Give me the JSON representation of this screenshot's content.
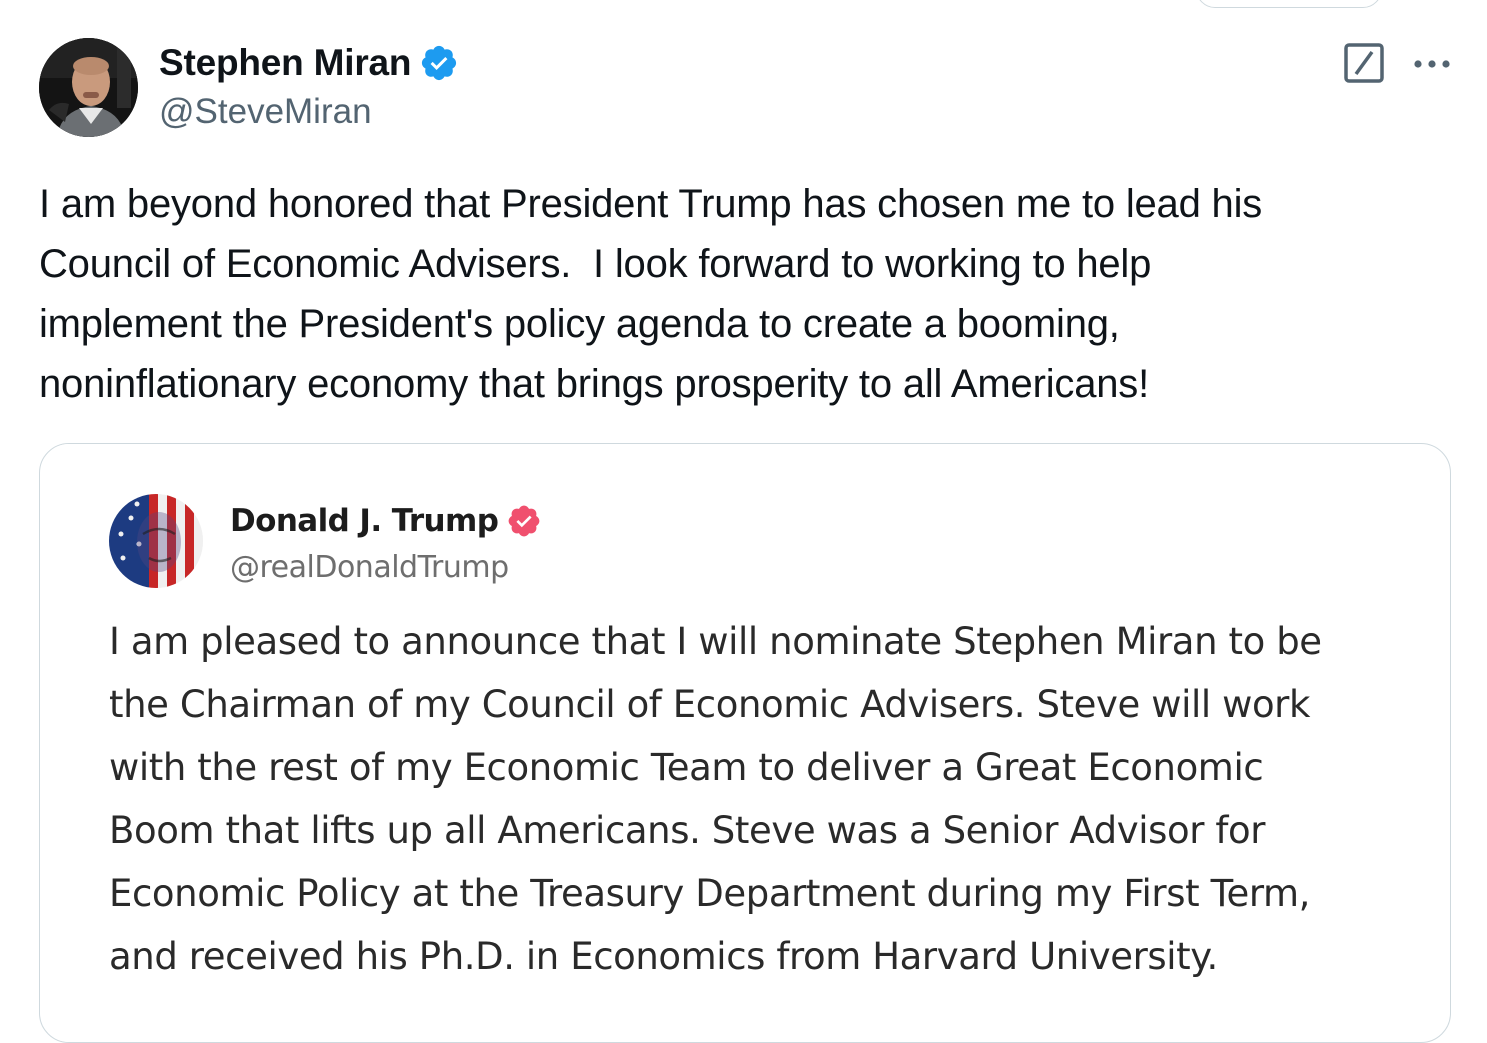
{
  "author": {
    "name": "Stephen Miran",
    "handle": "@SteveMiran",
    "verified": true,
    "badge_color": "#1d9bf0"
  },
  "tweet": {
    "text": "I am beyond honored that President Trump has chosen me to lead his\nCouncil of Economic Advisers.  I look forward to working to help\nimplement the President's policy agenda to create a booming,\nnoninflationary economy that brings prosperity to all Americans!"
  },
  "actions": {
    "grok_icon": "grok-icon",
    "more_icon": "more-options-icon"
  },
  "quoted": {
    "name": "Donald J. Trump",
    "handle": "@realDonaldTrump",
    "verified": true,
    "badge_color": "#f0506e",
    "text": "I am pleased to announce that I will nominate Stephen Miran to be\nthe Chairman of my Council of Economic Advisers. Steve will work\nwith the rest of my Economic Team to deliver a Great Economic\nBoom that lifts up all Americans. Steve was a Senior Advisor for\nEconomic Policy at the Treasury Department during my First Term,\nand received his Ph.D. in Economics from Harvard University."
  },
  "colors": {
    "text_primary": "#0f1419",
    "text_secondary": "#536471",
    "border": "#cfd9de"
  }
}
